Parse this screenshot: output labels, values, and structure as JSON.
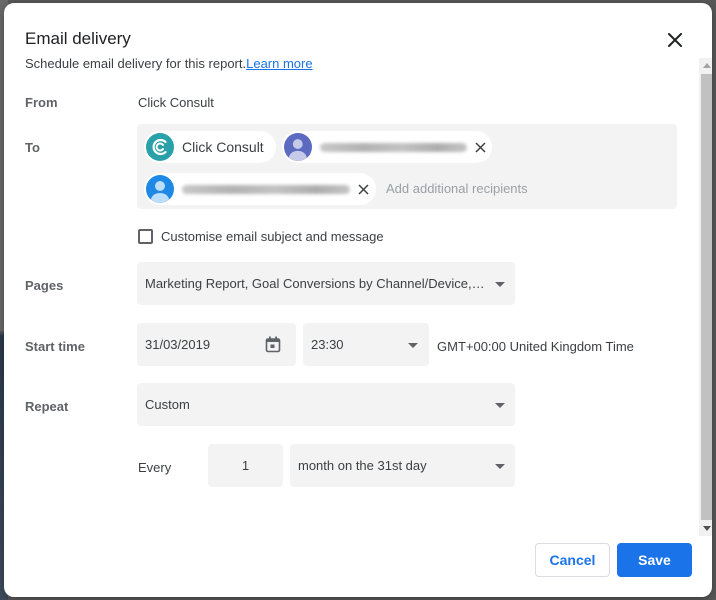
{
  "dialog": {
    "title": "Email delivery",
    "subtitle": "Schedule email delivery for this report.",
    "learn_more": "Learn more",
    "close_icon": "close-icon"
  },
  "from": {
    "label": "From",
    "value": "Click Consult"
  },
  "to": {
    "label": "To",
    "recipients": [
      {
        "name": "Click Consult",
        "avatar": "click-consult-logo",
        "removable": false,
        "avatar_color": "#2aa1a9"
      },
      {
        "name": "",
        "avatar": "person-icon",
        "removable": true,
        "redacted": true,
        "avatar_color": "#5c6bc0"
      },
      {
        "name": "",
        "avatar": "person-icon",
        "removable": true,
        "redacted": true,
        "avatar_color": "#1e88e5"
      }
    ],
    "add_placeholder": "Add additional recipients"
  },
  "customise": {
    "label": "Customise email subject and message",
    "checked": false
  },
  "pages": {
    "label": "Pages",
    "value": "Marketing Report, Goal Conversions by Channel/Device, K..."
  },
  "start_time": {
    "label": "Start time",
    "date": "31/03/2019",
    "time": "23:30",
    "timezone": "GMT+00:00 United Kingdom Time"
  },
  "repeat": {
    "label": "Repeat",
    "value": "Custom",
    "every_label": "Every",
    "every_count": "1",
    "every_unit": "month on the 31st day"
  },
  "actions": {
    "cancel": "Cancel",
    "save": "Save"
  },
  "colors": {
    "accent": "#1a73e8",
    "field_bg": "#f3f3f3"
  }
}
